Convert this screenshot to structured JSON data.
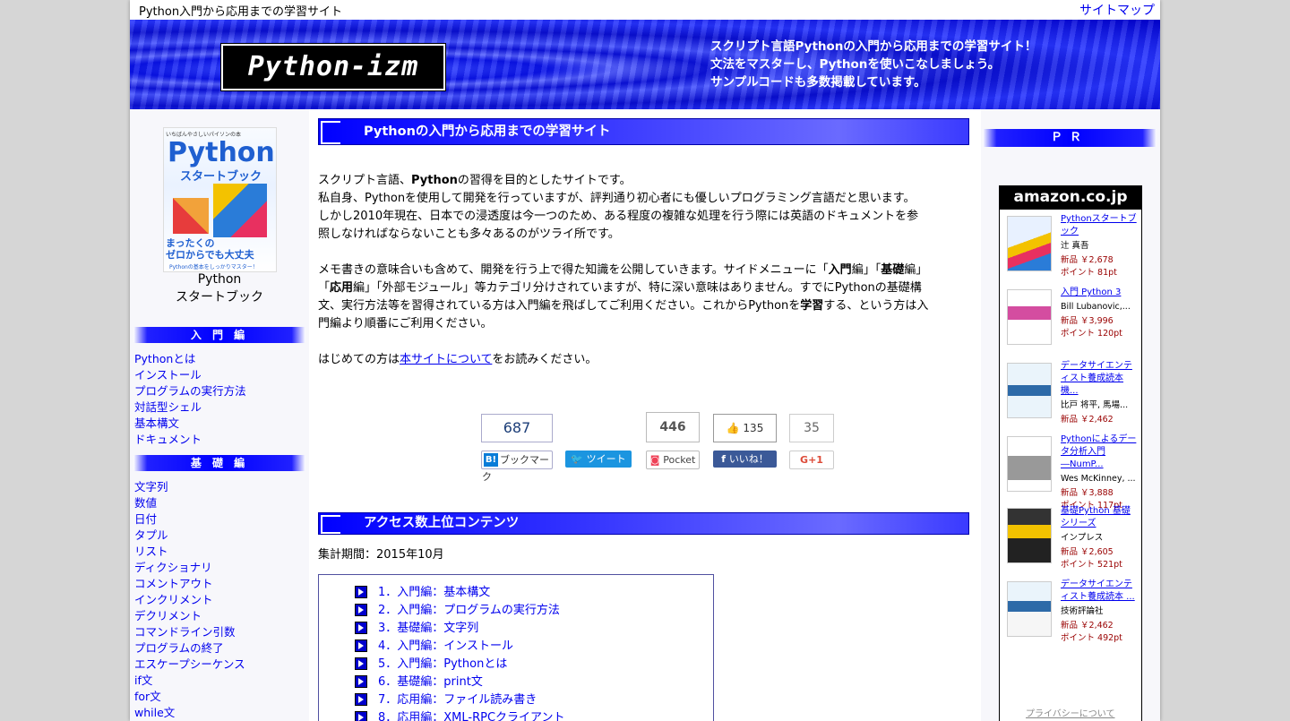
{
  "topbar": {
    "site_name": "Python入門から応用までの学習サイト",
    "sitemap": "サイトマップ"
  },
  "header": {
    "logo": "Python-izm",
    "tagline": [
      "スクリプト言語Pythonの入門から応用までの学習サイト！",
      "文法をマスターし、Pythonを使いこなしましょう。",
      "サンプルコードも多数掲載しています。"
    ]
  },
  "sidebar": {
    "book": {
      "cover_top": "いちばんやさしいパイソンの本",
      "cover_title": "Python",
      "cover_sub": "スタートブック",
      "cover_author": "辻 真吾",
      "cover_tag1": "まったくの",
      "cover_tag2": "ゼロからでも大丈夫",
      "cover_tag3": "Pythonの基本をしっかりマスター！",
      "caption_1": "Python",
      "caption_2": "スタートブック"
    },
    "intro_heading": "入 門 編",
    "intro_items": [
      "Pythonとは",
      "インストール",
      "プログラムの実行方法",
      "対話型シェル",
      "基本構文",
      "ドキュメント"
    ],
    "basic_heading": "基 礎 編",
    "basic_items": [
      "文字列",
      "数値",
      "日付",
      "タプル",
      "リスト",
      "ディクショナリ",
      "コメントアウト",
      "インクリメント",
      "デクリメント",
      "コマンドライン引数",
      "プログラムの終了",
      "エスケープシーケンス",
      "if文",
      "for文",
      "while文"
    ]
  },
  "main": {
    "title": "Pythonの入門から応用までの学習サイト",
    "p1": {
      "l1a": "スクリプト言語、",
      "l1b": "Python",
      "l1c": "の習得を目的としたサイトです。",
      "l2": "私自身、Pythonを使用して開発を行っていますが、評判通り初心者にも優しいプログラミング言語だと思います。",
      "l3": "しかし2010年現在、日本での浸透度は今一つのため、ある程度の複雑な処理を行う際には英語のドキュメントを参",
      "l4": "照しなければならないことも多々あるのがツライ所です。"
    },
    "p2": {
      "a": "メモ書きの意味合いも含めて、開発を行う上で得た知識を公開していきます。サイドメニューに「",
      "b": "入門",
      "c": "編」「",
      "d": "基礎",
      "e": "編」「",
      "f": "応用",
      "g": "編」「外部モジュール」等カテゴリ分けされていますが、特に深い意味はありません。すでにPythonの基礎構文、実行方法等を習得されている方は入門編を飛ばしてご利用ください。これからPythonを",
      "h": "学習",
      "i": "する、という方は入門編より順番にご利用ください。"
    },
    "p3": {
      "a": "はじめての方は",
      "link": "本サイトについて",
      "b": "をお読みください。"
    },
    "share": {
      "hatena_count": "687",
      "hatena_label": "ブックマーク",
      "tweet_label": "ツイート",
      "pocket_count": "446",
      "pocket_label": "Pocket",
      "like_count": "135",
      "like_label": "いいね！",
      "gplus_count": "35",
      "gplus_label": "G+1"
    },
    "ranking_title": "アクセス数上位コンテンツ",
    "period": "集計期間：2015年10月",
    "ranking": [
      "1．入門編：基本構文",
      "2．入門編：プログラムの実行方法",
      "3．基礎編：文字列",
      "4．入門編：インストール",
      "5．入門編：Pythonとは",
      "6．基礎編：print文",
      "7．応用編：ファイル読み書き",
      "8．応用編：XML-RPCクライアント"
    ]
  },
  "right": {
    "pr_heading": "ＰＲ",
    "amazon_logo": "amazon.co.jp",
    "items": [
      {
        "title": "Pythonスタートブック",
        "author": "辻 真吾",
        "price": "新品 ￥2,678",
        "points": "ポイント 81pt"
      },
      {
        "title": "入門 Python 3",
        "author": "Bill Lubanovic,...",
        "price": "新品 ￥3,996",
        "points": "ポイント 120pt"
      },
      {
        "title": "データサイエンティスト養成読本 機...",
        "author": "比戸 将平, 馬場...",
        "price": "新品 ￥2,462",
        "points": ""
      },
      {
        "title": "Pythonによるデータ分析入門 ―NumP...",
        "author": "Wes McKinney, ...",
        "price": "新品 ￥3,888",
        "points": "ポイント 117pt"
      },
      {
        "title": "基礎Python 基礎シリーズ",
        "author": "インプレス",
        "price": "新品 ￥2,605",
        "points": "ポイント 521pt"
      },
      {
        "title": "データサイエンティスト養成読本 ...",
        "author": "技術評論社",
        "price": "新品 ￥2,462",
        "points": "ポイント 492pt"
      }
    ],
    "privacy": "プライバシーについて"
  }
}
